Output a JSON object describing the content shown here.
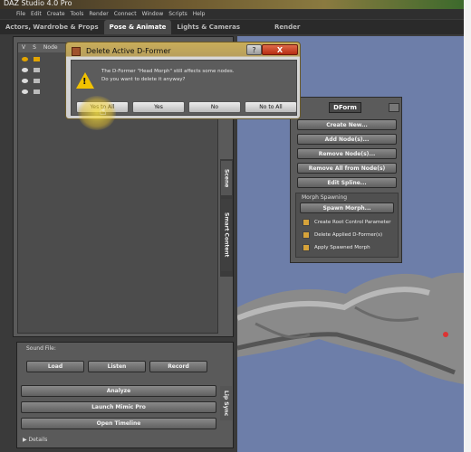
{
  "app": {
    "title": "DAZ Studio 4.0 Pro"
  },
  "menu": [
    "File",
    "Edit",
    "Create",
    "Tools",
    "Render",
    "Connect",
    "Window",
    "Scripts",
    "Help"
  ],
  "tabs": [
    {
      "label": "Actors, Wardrobe & Props",
      "active": false
    },
    {
      "label": "Pose & Animate",
      "active": true
    },
    {
      "label": "Lights & Cameras",
      "active": false
    },
    {
      "label": "Render",
      "active": false
    }
  ],
  "scene_panel": {
    "columns": [
      "V",
      "S",
      "Node"
    ],
    "side_tabs": [
      "Scene",
      "Smart Content"
    ]
  },
  "dialog": {
    "title": "Delete Active D-Former",
    "message_line1": "The D-Former \"Head Morph\" still affects some nodes.",
    "message_line2": "Do you want to delete it anyway?",
    "help_glyph": "?",
    "close_glyph": "X",
    "buttons": [
      "Yes to All",
      "Yes",
      "No",
      "No to All"
    ]
  },
  "lipsync_panel": {
    "sound_label": "Sound File:",
    "load": "Load",
    "listen": "Listen",
    "record": "Record",
    "analyze": "Analyze",
    "launch": "Launch Mimic Pro",
    "open_timeline": "Open Timeline",
    "tab": "Lip Sync",
    "details": "Details"
  },
  "dform": {
    "tab": "DForm",
    "buttons": [
      "Create New...",
      "Add Node(s)...",
      "Remove Node(s)...",
      "Remove All from Node(s)",
      "Edit Spline..."
    ],
    "group_label": "Morph Spawning",
    "spawn_button": "Spawn Morph...",
    "options": [
      {
        "label": "Create Root Control Parameter",
        "checked": true
      },
      {
        "label": "Delete Applied D-Former(s)",
        "checked": true
      },
      {
        "label": "Apply Spawned Morph",
        "checked": true
      }
    ]
  },
  "colors": {
    "viewport": "#6d7ea9",
    "panel": "#5a5a5a",
    "checkbox": "#d7a33a",
    "warning": "#f2c200"
  }
}
